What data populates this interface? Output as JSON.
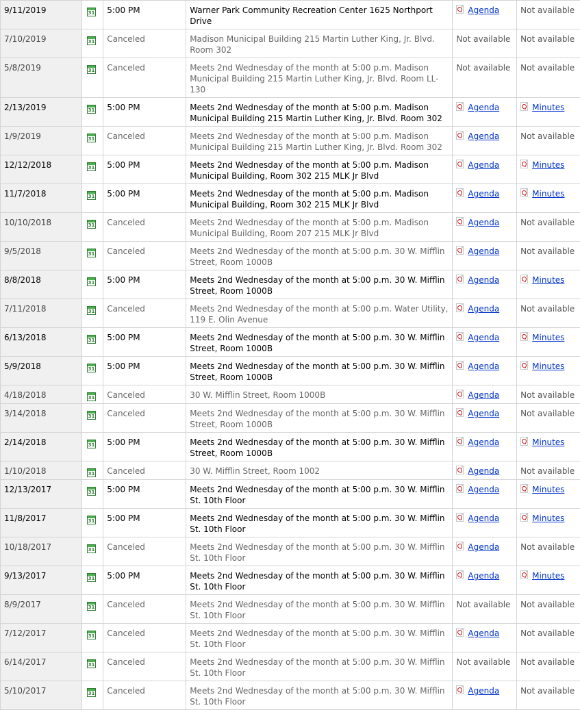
{
  "calendar_icon_text": "31",
  "rows": [
    {
      "date": "9/11/2019",
      "time": "5:00 PM",
      "location": "Warner Park Community Recreation Center 1625 Northport Drive",
      "agenda": "Agenda",
      "minutes": "Not available"
    },
    {
      "date": "7/10/2019",
      "time": "Canceled",
      "location": "Madison Municipal Building 215 Martin Luther King, Jr. Blvd. Room 302",
      "agenda": "Not available",
      "minutes": "Not available"
    },
    {
      "date": "5/8/2019",
      "time": "Canceled",
      "location": "Meets 2nd Wednesday of the month at 5:00 p.m. Madison Municipal Building 215 Martin Luther King, Jr. Blvd. Room LL-130",
      "agenda": "Not available",
      "minutes": "Not available"
    },
    {
      "date": "2/13/2019",
      "time": "5:00 PM",
      "location": "Meets 2nd Wednesday of the month at 5:00 p.m. Madison Municipal Building 215 Martin Luther King, Jr. Blvd. Room 302",
      "agenda": "Agenda",
      "minutes": "Minutes"
    },
    {
      "date": "1/9/2019",
      "time": "Canceled",
      "location": "Meets 2nd Wednesday of the month at 5:00 p.m. Madison Municipal Building 215 Martin Luther King, Jr. Blvd. Room 302",
      "agenda": "Agenda",
      "minutes": "Not available"
    },
    {
      "date": "12/12/2018",
      "time": "5:00 PM",
      "location": "Meets 2nd Wednesday of the month at 5:00 p.m. Madison Municipal Building, Room 302 215 MLK Jr Blvd",
      "agenda": "Agenda",
      "minutes": "Minutes"
    },
    {
      "date": "11/7/2018",
      "time": "5:00 PM",
      "location": "Meets 2nd Wednesday of the month at 5:00 p.m. Madison Municipal Building, Room 302 215 MLK Jr Blvd",
      "agenda": "Agenda",
      "minutes": "Minutes"
    },
    {
      "date": "10/10/2018",
      "time": "Canceled",
      "location": "Meets 2nd Wednesday of the month at 5:00 p.m. Madison Municipal Building, Room 207 215 MLK Jr Blvd",
      "agenda": "Agenda",
      "minutes": "Not available"
    },
    {
      "date": "9/5/2018",
      "time": "Canceled",
      "location": "Meets 2nd Wednesday of the month at 5:00 p.m. 30 W. Mifflin Street, Room 1000B",
      "agenda": "Agenda",
      "minutes": "Not available"
    },
    {
      "date": "8/8/2018",
      "time": "5:00 PM",
      "location": "Meets 2nd Wednesday of the month at 5:00 p.m. 30 W. Mifflin Street, Room 1000B",
      "agenda": "Agenda",
      "minutes": "Minutes"
    },
    {
      "date": "7/11/2018",
      "time": "Canceled",
      "location": "Meets 2nd Wednesday of the month at 5:00 p.m. Water Utility, 119 E. Olin Avenue",
      "agenda": "Agenda",
      "minutes": "Not available"
    },
    {
      "date": "6/13/2018",
      "time": "5:00 PM",
      "location": "Meets 2nd Wednesday of the month at 5:00 p.m. 30 W. Mifflin Street, Room 1000B",
      "agenda": "Agenda",
      "minutes": "Minutes"
    },
    {
      "date": "5/9/2018",
      "time": "5:00 PM",
      "location": "Meets 2nd Wednesday of the month at 5:00 p.m. 30 W. Mifflin Street, Room 1000B",
      "agenda": "Agenda",
      "minutes": "Minutes"
    },
    {
      "date": "4/18/2018",
      "time": "Canceled",
      "location": "30 W. Mifflin Street, Room 1000B",
      "agenda": "Agenda",
      "minutes": "Not available"
    },
    {
      "date": "3/14/2018",
      "time": "Canceled",
      "location": "Meets 2nd Wednesday of the month at 5:00 p.m. 30 W. Mifflin Street, Room 1000B",
      "agenda": "Agenda",
      "minutes": "Not available"
    },
    {
      "date": "2/14/2018",
      "time": "5:00 PM",
      "location": "Meets 2nd Wednesday of the month at 5:00 p.m. 30 W. Mifflin Street, Room 1000B",
      "agenda": "Agenda",
      "minutes": "Minutes"
    },
    {
      "date": "1/10/2018",
      "time": "Canceled",
      "location": "30 W. Mifflin Street, Room 1002",
      "agenda": "Agenda",
      "minutes": "Not available"
    },
    {
      "date": "12/13/2017",
      "time": "5:00 PM",
      "location": "Meets 2nd Wednesday of the month at 5:00 p.m. 30 W. Mifflin St. 10th Floor",
      "agenda": "Agenda",
      "minutes": "Minutes"
    },
    {
      "date": "11/8/2017",
      "time": "5:00 PM",
      "location": "Meets 2nd Wednesday of the month at 5:00 p.m. 30 W. Mifflin St. 10th Floor",
      "agenda": "Agenda",
      "minutes": "Minutes"
    },
    {
      "date": "10/18/2017",
      "time": "Canceled",
      "location": "Meets 2nd Wednesday of the month at 5:00 p.m. 30 W. Mifflin St. 10th Floor",
      "agenda": "Agenda",
      "minutes": "Not available"
    },
    {
      "date": "9/13/2017",
      "time": "5:00 PM",
      "location": "Meets 2nd Wednesday of the month at 5:00 p.m. 30 W. Mifflin St. 10th Floor",
      "agenda": "Agenda",
      "minutes": "Minutes"
    },
    {
      "date": "8/9/2017",
      "time": "Canceled",
      "location": "Meets 2nd Wednesday of the month at 5:00 p.m. 30 W. Mifflin St. 10th Floor",
      "agenda": "Not available",
      "minutes": "Not available"
    },
    {
      "date": "7/12/2017",
      "time": "Canceled",
      "location": "Meets 2nd Wednesday of the month at 5:00 p.m. 30 W. Mifflin St. 10th Floor",
      "agenda": "Agenda",
      "minutes": "Not available"
    },
    {
      "date": "6/14/2017",
      "time": "Canceled",
      "location": "Meets 2nd Wednesday of the month at 5:00 p.m. 30 W. Mifflin St. 10th Floor",
      "agenda": "Not available",
      "minutes": "Not available"
    },
    {
      "date": "5/10/2017",
      "time": "Canceled",
      "location": "Meets 2nd Wednesday of the month at 5:00 p.m. 30 W. Mifflin St. 10th Floor",
      "agenda": "Agenda",
      "minutes": "Not available"
    }
  ]
}
